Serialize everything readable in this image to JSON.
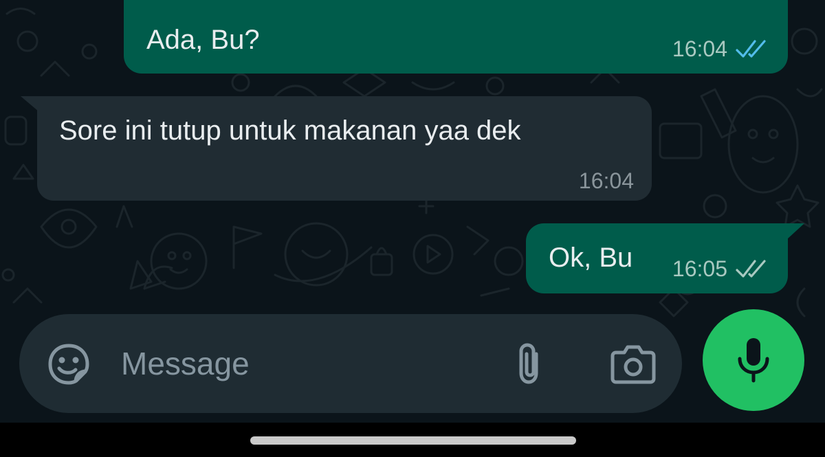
{
  "messages": [
    {
      "direction": "outgoing",
      "text": "Ada, Bu?",
      "time": "16:04",
      "status": "read",
      "status_icon": "double-check-icon"
    },
    {
      "direction": "incoming",
      "text": "Sore ini tutup untuk makanan yaa dek",
      "time": "16:04"
    },
    {
      "direction": "outgoing",
      "text": "Ok, Bu",
      "time": "16:05",
      "status": "delivered",
      "status_icon": "double-check-icon"
    }
  ],
  "composer": {
    "placeholder": "Message",
    "value": "",
    "emoji_icon": "sticker-icon",
    "attach_icon": "paperclip-icon",
    "camera_icon": "camera-icon",
    "send_icon": "microphone-icon"
  },
  "colors": {
    "chat_background": "#0b141a",
    "outgoing_bubble": "#005c4b",
    "incoming_bubble": "#202c33",
    "composer_background": "#1f2c33",
    "mic_button": "#21c063",
    "read_ticks": "#53bdeb",
    "delivered_ticks": "#a9c9c1"
  }
}
